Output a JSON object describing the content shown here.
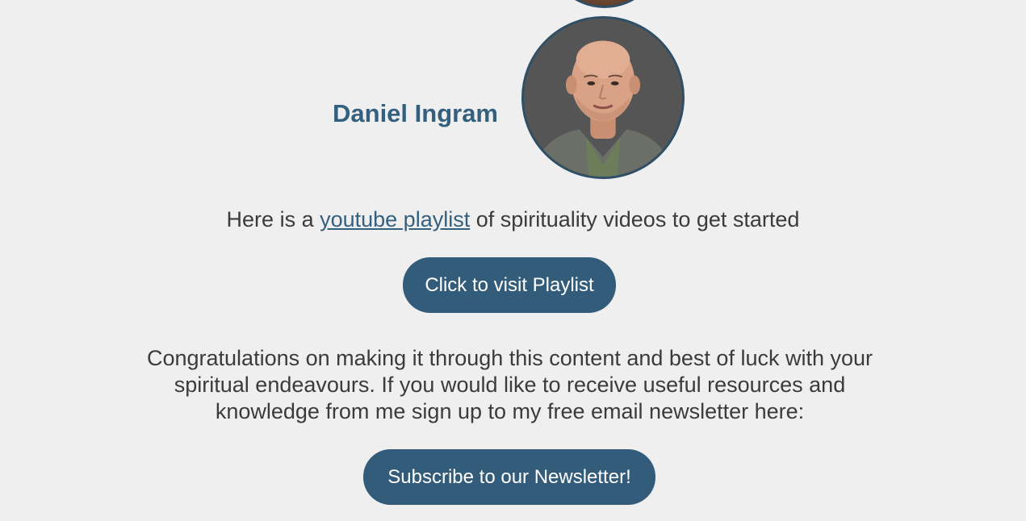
{
  "person": {
    "name": "Daniel Ingram",
    "avatar_alt": "Daniel Ingram portrait"
  },
  "playlist": {
    "prefix": "Here is a ",
    "link_text": "youtube playlist",
    "suffix": " of spirituality videos to get started",
    "button_label": "Click to visit Playlist"
  },
  "newsletter": {
    "message": "Congratulations on making it through this content and best of luck with your spiritual endeavours. If you would like to receive useful resources and knowledge from me sign up to my free email newsletter here:",
    "button_label": "Subscribe to our Newsletter!"
  },
  "colors": {
    "background": "#efefef",
    "accent": "#335c7a",
    "link": "#34607f",
    "text": "#3b3b3b"
  }
}
